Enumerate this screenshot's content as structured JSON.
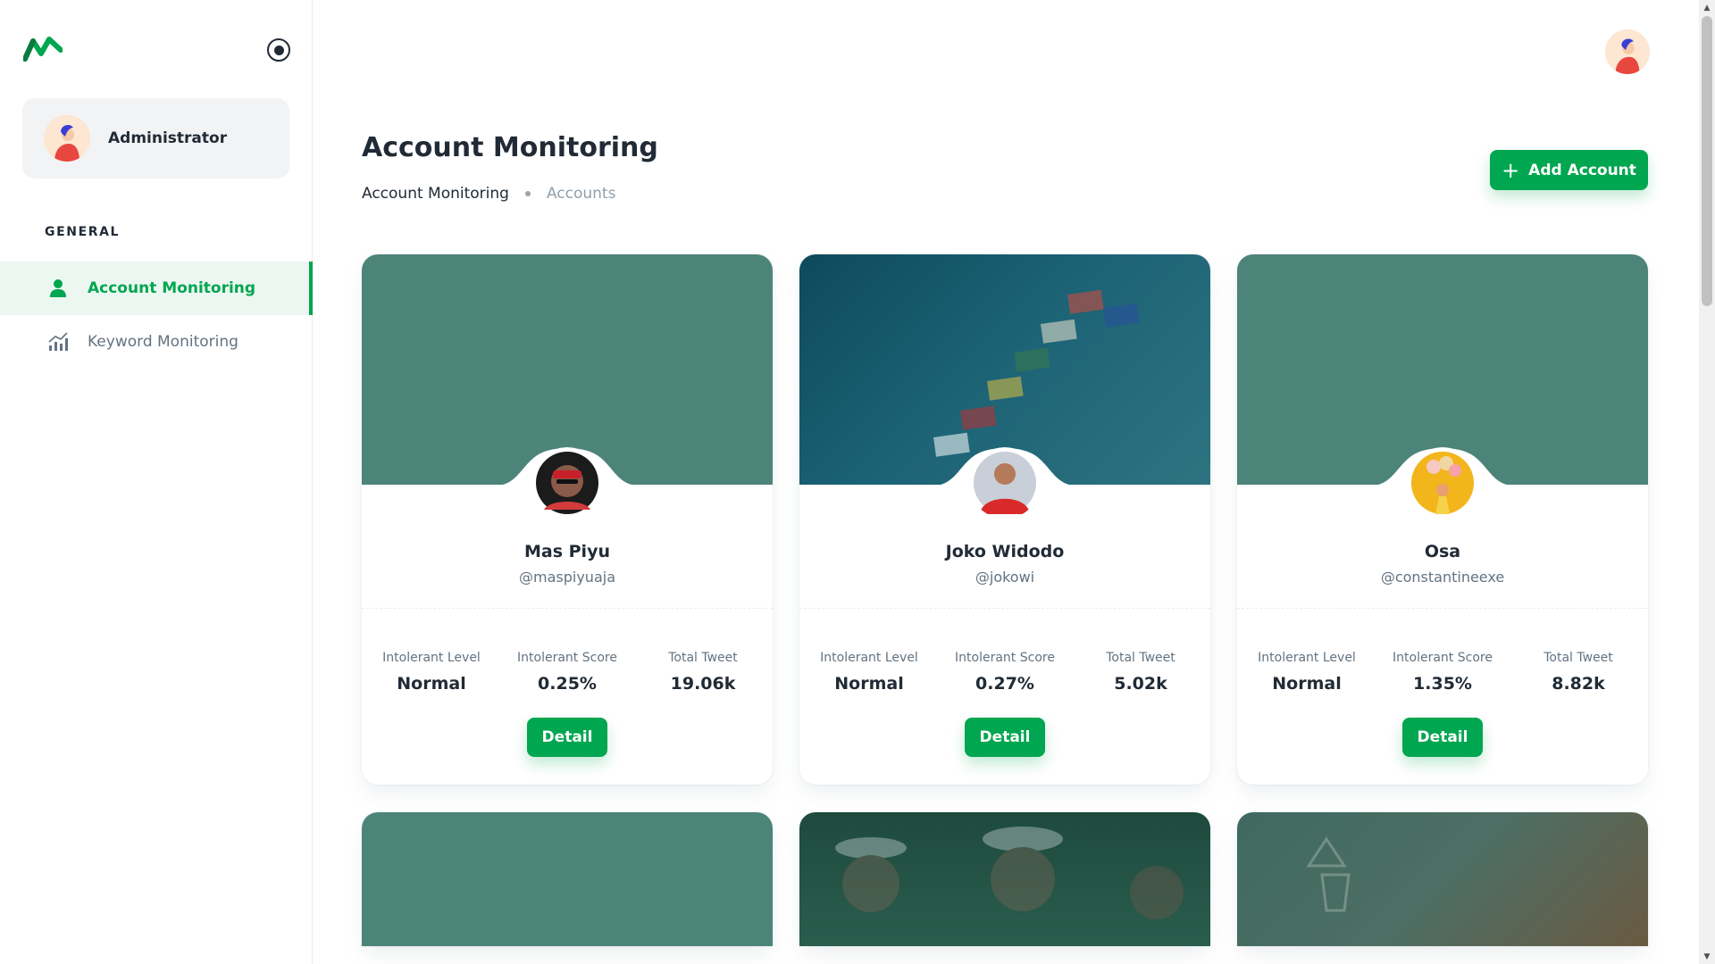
{
  "sidebar": {
    "user": {
      "name": "Administrator"
    },
    "section_label": "GENERAL",
    "items": [
      {
        "label": "Account Monitoring",
        "icon": "user-icon",
        "active": true
      },
      {
        "label": "Keyword Monitoring",
        "icon": "bar-chart-icon",
        "active": false
      }
    ]
  },
  "header": {
    "title": "Account Monitoring",
    "breadcrumb": [
      "Account Monitoring",
      "Accounts"
    ],
    "add_button_label": "Add Account"
  },
  "stat_labels": {
    "level": "Intolerant Level",
    "score": "Intolerant Score",
    "tweets": "Total Tweet"
  },
  "accounts": [
    {
      "name": "Mas Piyu",
      "handle": "@maspiyuaja",
      "intolerant_level": "Normal",
      "intolerant_score": "0.25%",
      "total_tweet": "19.06k",
      "detail_label": "Detail"
    },
    {
      "name": "Joko Widodo",
      "handle": "@jokowi",
      "intolerant_level": "Normal",
      "intolerant_score": "0.27%",
      "total_tweet": "5.02k",
      "detail_label": "Detail"
    },
    {
      "name": "Osa",
      "handle": "@constantineexe",
      "intolerant_level": "Normal",
      "intolerant_score": "1.35%",
      "total_tweet": "8.82k",
      "detail_label": "Detail"
    }
  ],
  "colors": {
    "primary": "#00a650",
    "cover_default": "#4d847a",
    "text": "#212b36",
    "muted": "#637381"
  }
}
